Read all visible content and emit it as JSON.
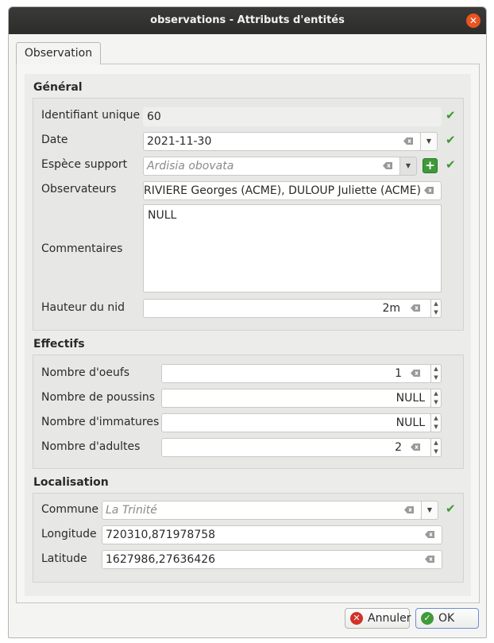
{
  "window": {
    "title": "observations - Attributs d'entités"
  },
  "tab": {
    "label": "Observation"
  },
  "sections": {
    "general": "Général",
    "effectifs": "Effectifs",
    "localisation": "Localisation"
  },
  "general": {
    "id_label": "Identifiant unique",
    "id_value": "60",
    "date_label": "Date",
    "date_value": "2021-11-30",
    "espece_label": "Espèce support",
    "espece_placeholder": "Ardisia obovata",
    "observateurs_label": "Observateurs",
    "observateurs_value": "RIVIERE Georges (ACME), DULOUP Juliette (ACME)",
    "commentaires_label": "Commentaires",
    "commentaires_value": "NULL",
    "hauteur_label": "Hauteur du nid",
    "hauteur_value": "2m"
  },
  "effectifs": {
    "oeufs_label": "Nombre d'oeufs",
    "oeufs_value": "1",
    "poussins_label": "Nombre de poussins",
    "poussins_value": "NULL",
    "immatures_label": "Nombre d'immatures",
    "immatures_value": "NULL",
    "adultes_label": "Nombre d'adultes",
    "adultes_value": "2"
  },
  "localisation": {
    "commune_label": "Commune",
    "commune_placeholder": "La Trinité",
    "longitude_label": "Longitude",
    "longitude_value": "720310,871978758",
    "latitude_label": "Latitude",
    "latitude_value": "1627986,27636426"
  },
  "buttons": {
    "cancel": "Annuler",
    "ok": "OK"
  },
  "colors": {
    "titlebar": "#2c2c2a",
    "close": "#e95420",
    "check": "#3c9a2e",
    "cancel_icon": "#d0322a",
    "ok_icon": "#3f9a3a"
  },
  "icons": [
    "close-icon",
    "clear-icon",
    "dropdown-arrow-icon",
    "plus-icon",
    "check-icon",
    "spin-up-icon",
    "spin-down-icon",
    "cancel-icon",
    "ok-icon"
  ]
}
